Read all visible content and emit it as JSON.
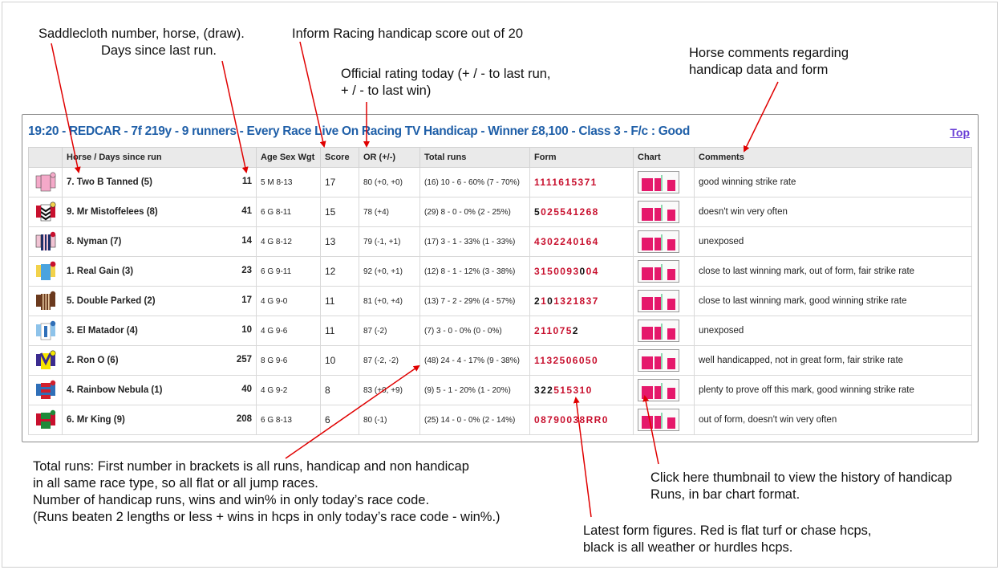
{
  "annotations": {
    "saddlecloth": [
      "Saddlecloth number, horse, (draw).",
      "Days since last run."
    ],
    "inform_score": [
      "Inform Racing handicap score out of 20"
    ],
    "official_rating": [
      "Official rating today (+ / - to last run,",
      "+ / - to last win)"
    ],
    "comments": [
      "Horse comments regarding",
      "handicap data and form"
    ],
    "total_runs": [
      "Total runs: First number in brackets is all runs, handicap and non handicap",
      "in all same race type, so all flat or all jump races.",
      "Number of handicap runs, wins and win% in only today’s race code.",
      "(Runs beaten 2 lengths or less + wins in hcps in only today’s race code - win%.)"
    ],
    "chart_thumb": [
      "Click here thumbnail to view the history of handicap",
      "Runs, in bar chart format."
    ],
    "form_figures": [
      "Latest form figures. Red is flat turf or chase hcps,",
      "black is all weather or hurdles hcps."
    ]
  },
  "race": {
    "title": "19:20 - REDCAR - 7f 219y - 9 runners - Every Race Live On Racing TV Handicap - Winner £8,100 - Class 3 - F/c : Good",
    "top_link": "Top"
  },
  "columns": [
    "Horse / Days since run",
    "Age Sex Wgt",
    "Score",
    "OR (+/-)",
    "Total runs",
    "Form",
    "Chart",
    "Comments"
  ],
  "runners": [
    {
      "silk": "silk-pink",
      "horse": "7. Two B Tanned (5)",
      "days": "11",
      "age_sex_wgt": "5 M 8-13",
      "score": "17",
      "or": "80 (+0, +0)",
      "total_runs": "(16) 10 - 6 - 60% (7 - 70%)",
      "form": [
        [
          "r",
          "1111615371"
        ]
      ],
      "comment": "good winning strike rate"
    },
    {
      "silk": "silk-redblack-chevrons",
      "horse": "9. Mr Mistoffelees (8)",
      "days": "41",
      "age_sex_wgt": "6 G 8-11",
      "score": "15",
      "or": "78 (+4)",
      "total_runs": "(29) 8 - 0 - 0% (2 - 25%)",
      "form": [
        [
          "b",
          "5"
        ],
        [
          "r",
          "025541268"
        ]
      ],
      "comment": "doesn't win very often"
    },
    {
      "silk": "silk-navy-stripes",
      "horse": "8. Nyman (7)",
      "days": "14",
      "age_sex_wgt": "4 G 8-12",
      "score": "13",
      "or": "79 (-1, +1)",
      "total_runs": "(17) 3 - 1 - 33% (1 - 33%)",
      "form": [
        [
          "r",
          "4302240164"
        ]
      ],
      "comment": "unexposed"
    },
    {
      "silk": "silk-lightblue-yellow",
      "horse": "1. Real Gain (3)",
      "days": "23",
      "age_sex_wgt": "6 G 9-11",
      "score": "12",
      "or": "92 (+0, +1)",
      "total_runs": "(12) 8 - 1 - 12% (3 - 38%)",
      "form": [
        [
          "r",
          "3150093"
        ],
        [
          "b",
          "0"
        ],
        [
          "r",
          "04"
        ]
      ],
      "comment": "close to last winning mark, out of form, fair strike rate"
    },
    {
      "silk": "silk-brown-stripes",
      "horse": "5. Double Parked (2)",
      "days": "17",
      "age_sex_wgt": "4 G 9-0",
      "score": "11",
      "or": "81 (+0, +4)",
      "total_runs": "(13) 7 - 2 - 29% (4 - 57%)",
      "form": [
        [
          "b",
          "2"
        ],
        [
          "r",
          "1"
        ],
        [
          "b",
          "0"
        ],
        [
          "r",
          "1321837"
        ]
      ],
      "comment": "close to last winning mark, good winning strike rate"
    },
    {
      "silk": "silk-white-blue",
      "horse": "3. El Matador (4)",
      "days": "10",
      "age_sex_wgt": "4 G 9-6",
      "score": "11",
      "or": "87 (-2)",
      "total_runs": "(7) 3 - 0 - 0% (0 - 0%)",
      "form": [
        [
          "r",
          "211075"
        ],
        [
          "b",
          "2"
        ]
      ],
      "comment": "unexposed"
    },
    {
      "silk": "silk-yellow-purple",
      "horse": "2. Ron O (6)",
      "days": "257",
      "age_sex_wgt": "8 G 9-6",
      "score": "10",
      "or": "87 (-2, -2)",
      "total_runs": "(48) 24 - 4 - 17% (9 - 38%)",
      "form": [
        [
          "r",
          "1132506050"
        ]
      ],
      "comment": "well handicapped, not in great form, fair strike rate"
    },
    {
      "silk": "silk-red-blue",
      "horse": "4. Rainbow Nebula (1)",
      "days": "40",
      "age_sex_wgt": "4 G 9-2",
      "score": "8",
      "or": "83 (+0, +9)",
      "total_runs": "(9) 5 - 1 - 20% (1 - 20%)",
      "form": [
        [
          "b",
          "322"
        ],
        [
          "r",
          "515310"
        ]
      ],
      "comment": "plenty to prove off this mark, good winning strike rate"
    },
    {
      "silk": "silk-green-red",
      "horse": "6. Mr King (9)",
      "days": "208",
      "age_sex_wgt": "6 G 8-13",
      "score": "6",
      "or": "80 (-1)",
      "total_runs": "(25) 14 - 0 - 0% (2 - 14%)",
      "form": [
        [
          "r",
          "08790038RR0"
        ]
      ],
      "comment": "out of form, doesn't win very often"
    }
  ],
  "colors": {
    "title_blue": "#1f5fa8",
    "form_red": "#c8102e",
    "form_black": "#111111",
    "bar_pink": "#e5186b",
    "bar_green": "#8ed6b0",
    "arrow_red": "#e00000"
  }
}
